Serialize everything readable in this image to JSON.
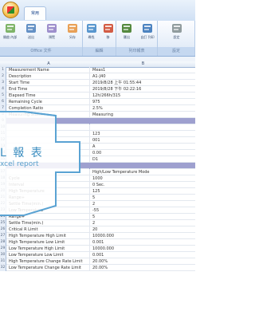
{
  "ribbon": {
    "home_tab": "常用",
    "tools": [
      {
        "label": "開啟 內部 並",
        "icon": "copy-icon"
      },
      {
        "label": "送出",
        "icon": "print-icon"
      },
      {
        "label": "預覽",
        "icon": "preview-icon"
      },
      {
        "label": "另存",
        "icon": "find-icon"
      },
      {
        "label": "尋找",
        "icon": "binoculars-icon"
      },
      {
        "label": "移",
        "icon": "move-icon"
      },
      {
        "label": "匯出",
        "icon": "export-icon"
      },
      {
        "label": "自訂 列印",
        "icon": "chart-icon"
      },
      {
        "label": "設定",
        "icon": "settings-icon"
      }
    ],
    "groups": [
      "Office 文件",
      "編輯",
      "列印報表",
      "設定"
    ]
  },
  "sheet": {
    "columns": [
      "A",
      "B"
    ],
    "rows": [
      {
        "n": "1",
        "a": "Measurement Name",
        "b": "Meas1"
      },
      {
        "n": "2",
        "a": "Description",
        "b": "A1-J40"
      },
      {
        "n": "3",
        "a": "Start Time",
        "b": "2019/8/28 上午 01:55:44"
      },
      {
        "n": "4",
        "a": "End Time",
        "b": "2019/8/28 下午 02:22:16"
      },
      {
        "n": "5",
        "a": "Elapsed Time",
        "b": "12h/266h/315"
      },
      {
        "n": "6",
        "a": "Remaining Cycle",
        "b": "975"
      },
      {
        "n": "7",
        "a": "Completion Ratio",
        "b": "2.5%"
      },
      {
        "n": "8",
        "a": "Measuring Status",
        "b": "Measuring"
      },
      {
        "n": "9",
        "a": "",
        "b": "",
        "section": true
      },
      {
        "n": "10",
        "a": "",
        "b": ""
      },
      {
        "n": "11",
        "a": "",
        "b": "123"
      },
      {
        "n": "12",
        "a": "",
        "b": "001"
      },
      {
        "n": "13",
        "a": "",
        "b": "A"
      },
      {
        "n": "14",
        "a": "",
        "b": "0.00"
      },
      {
        "n": "15",
        "a": "",
        "b": "D1"
      },
      {
        "n": "16",
        "a": "",
        "b": "",
        "section": true
      },
      {
        "n": "17",
        "a": "",
        "b": "High/Low Temperature Mode"
      },
      {
        "n": "18",
        "a": "Cycle",
        "b": "1000"
      },
      {
        "n": "19",
        "a": "Interval",
        "b": "0 Sec."
      },
      {
        "n": "20",
        "a": "High Temperature",
        "b": "125"
      },
      {
        "n": "21",
        "a": "Range+",
        "b": "5"
      },
      {
        "n": "22",
        "a": "Settle Time(min.)",
        "b": "2"
      },
      {
        "n": "23",
        "a": "Low Temperature",
        "b": "-55"
      },
      {
        "n": "24",
        "a": "Range+",
        "b": "5"
      },
      {
        "n": "25",
        "a": "Settle Time(min.)",
        "b": "2"
      },
      {
        "n": "26",
        "a": "Critical R Limit",
        "b": "20"
      },
      {
        "n": "27",
        "a": "High Temperature High Limit",
        "b": "10000.000"
      },
      {
        "n": "28",
        "a": "High Temperature Low Limit",
        "b": "0.001"
      },
      {
        "n": "29",
        "a": "Low Temperature High Limit",
        "b": "10000.000"
      },
      {
        "n": "30",
        "a": "Low Temperature Low Limit",
        "b": "0.001"
      },
      {
        "n": "31",
        "a": "High Temperature Change Rate Limit",
        "b": "20.00%"
      },
      {
        "n": "32",
        "a": "Low Temperature Change Rate Limit",
        "b": "20.00%"
      }
    ]
  },
  "callout": {
    "title": "L 報 表",
    "subtitle": "xcel report",
    "border_color": "#5aa3d3"
  }
}
